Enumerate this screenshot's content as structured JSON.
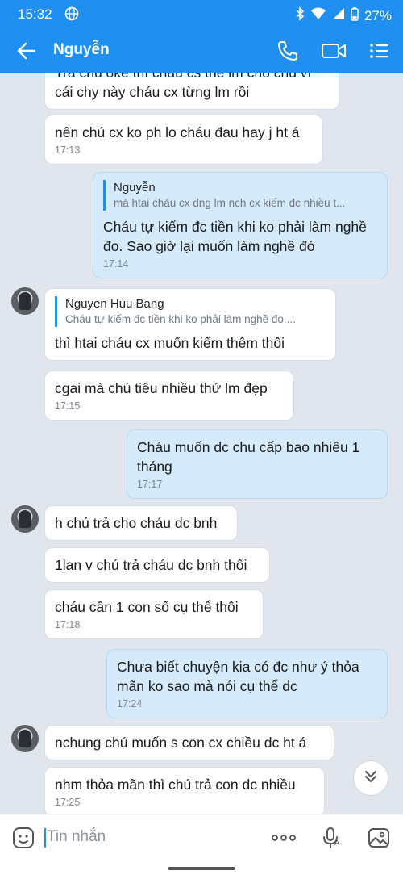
{
  "status_bar": {
    "time": "15:32",
    "battery": "27%"
  },
  "header": {
    "title": "Nguyễn"
  },
  "messages": [
    {
      "text": "Trả chú oke thì cháu cs thể lm cho chú vì cái chy này cháu cx từng lm rồi",
      "time": ""
    },
    {
      "text": "nên chú cx ko ph lo cháu đau hay j ht á",
      "time": "17:13"
    },
    {
      "quote_name": "Nguyễn",
      "quote_text": "mà htai cháu cx dng lm nch cx kiếm dc nhiều t...",
      "text": "Cháu tự kiếm đc tiền khi ko phải làm nghề đo. Sao giờ lại muốn làm nghề đó",
      "time": "17:14"
    },
    {
      "quote_name": "Nguyen Huu Bang",
      "quote_text": "Cháu tự kiếm đc tiền khi ko phải làm nghề đo....",
      "text": "thì htai cháu cx muốn kiếm thêm thôi",
      "time": ""
    },
    {
      "text": "cgai mà chú tiêu nhiều thứ lm đẹp",
      "time": "17:15"
    },
    {
      "text": "Cháu muốn dc chu cấp bao nhiêu 1 tháng",
      "time": "17:17"
    },
    {
      "text": "h chú trả cho cháu dc bnh",
      "time": ""
    },
    {
      "text": "1lan v chú trả cháu dc bnh thôi",
      "time": ""
    },
    {
      "text": "cháu cần 1 con số cụ thể thôi",
      "time": "17:18"
    },
    {
      "text": "Chưa biết chuyện kia có đc như ý thỏa mãn ko sao mà nói cụ thể dc",
      "time": "17:24"
    },
    {
      "text": "nchung chú muốn s con cx chiều dc ht á",
      "time": ""
    },
    {
      "text": "nhm thỏa mãn thì chú trả con dc nhiều",
      "time": "17:25"
    }
  ],
  "input": {
    "placeholder": "Tin nhắn"
  }
}
